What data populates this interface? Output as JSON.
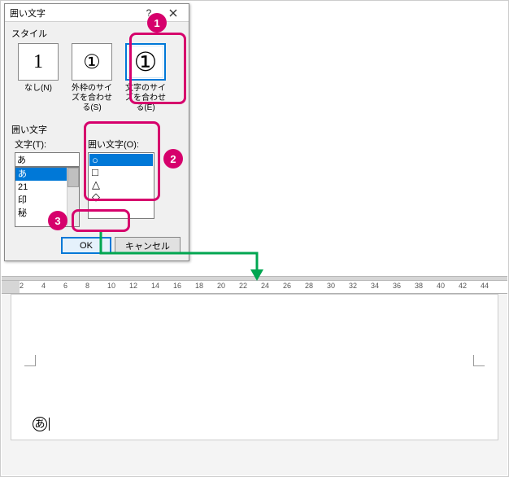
{
  "dialog": {
    "title": "囲い文字",
    "help_label": "?",
    "section_style": "スタイル",
    "section_enclose": "囲い文字",
    "styles": {
      "none": {
        "icon": "1",
        "label": "なし(N)"
      },
      "shrink_frame": {
        "icon": "①",
        "label": "外枠のサイズを合わせる(S)"
      },
      "shrink_text": {
        "icon": "①",
        "label": "文字のサイズを合わせる(E)"
      }
    },
    "text_col": {
      "label": "文字(T):",
      "value": "あ",
      "items": [
        "あ",
        "21",
        "印",
        "秘"
      ]
    },
    "shape_col": {
      "label": "囲い文字(O):",
      "items": [
        "○",
        "□",
        "△",
        "◇"
      ]
    },
    "buttons": {
      "ok": "OK",
      "cancel": "キャンセル"
    }
  },
  "markers": {
    "m1": "1",
    "m2": "2",
    "m3": "3"
  },
  "ruler_numbers": [
    2,
    4,
    6,
    8,
    10,
    12,
    14,
    16,
    18,
    20,
    22,
    24,
    26,
    28,
    30,
    32,
    34,
    36,
    38,
    40,
    42,
    44
  ],
  "doc_char": "あ"
}
